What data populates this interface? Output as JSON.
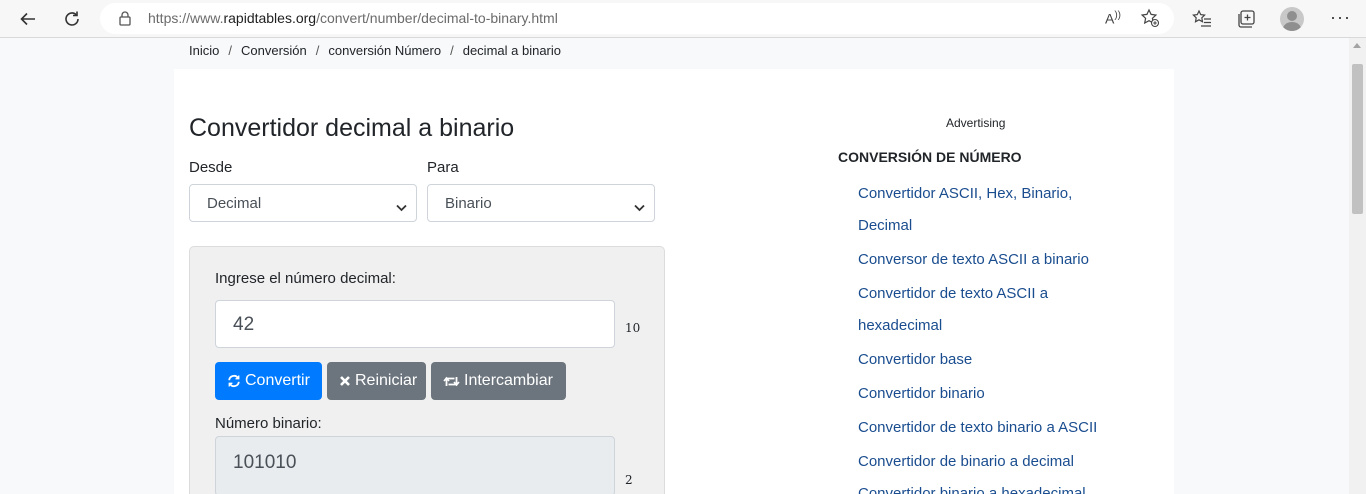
{
  "browser": {
    "url_prefix": "https://www.",
    "url_domain": "rapidtables.org",
    "url_path": "/convert/number/decimal-to-binary.html",
    "read_aloud": "A̅¹",
    "more": "···"
  },
  "breadcrumb": {
    "items": [
      "Inicio",
      "Conversión",
      "conversión Número",
      "decimal a binario"
    ],
    "separator": "/"
  },
  "page": {
    "title": "Convertidor decimal a binario",
    "from_label": "Desde",
    "to_label": "Para",
    "from_value": "Decimal",
    "to_value": "Binario",
    "input_label": "Ingrese el número decimal:",
    "input_value": "42",
    "input_base": "10",
    "convert_label": "Convertir",
    "reset_label": "Reiniciar",
    "swap_label": "Intercambiar",
    "output_label": "Número binario:",
    "output_value": "101010",
    "output_base": "2"
  },
  "sidebar": {
    "advertising": "Advertising",
    "title": "CONVERSIÓN DE NÚMERO",
    "links": [
      "Convertidor ASCII, Hex, Binario,",
      "Decimal",
      "Conversor de texto ASCII a binario",
      "Convertidor de texto ASCII a",
      "hexadecimal",
      "Convertidor base",
      "Convertidor binario",
      "Convertidor de texto binario a ASCII",
      "Convertidor de binario a decimal",
      "Convertidor binario a hexadecimal"
    ]
  },
  "colors": {
    "primary": "#007bff",
    "secondary": "#6c757d",
    "link": "#1a4d8f"
  }
}
